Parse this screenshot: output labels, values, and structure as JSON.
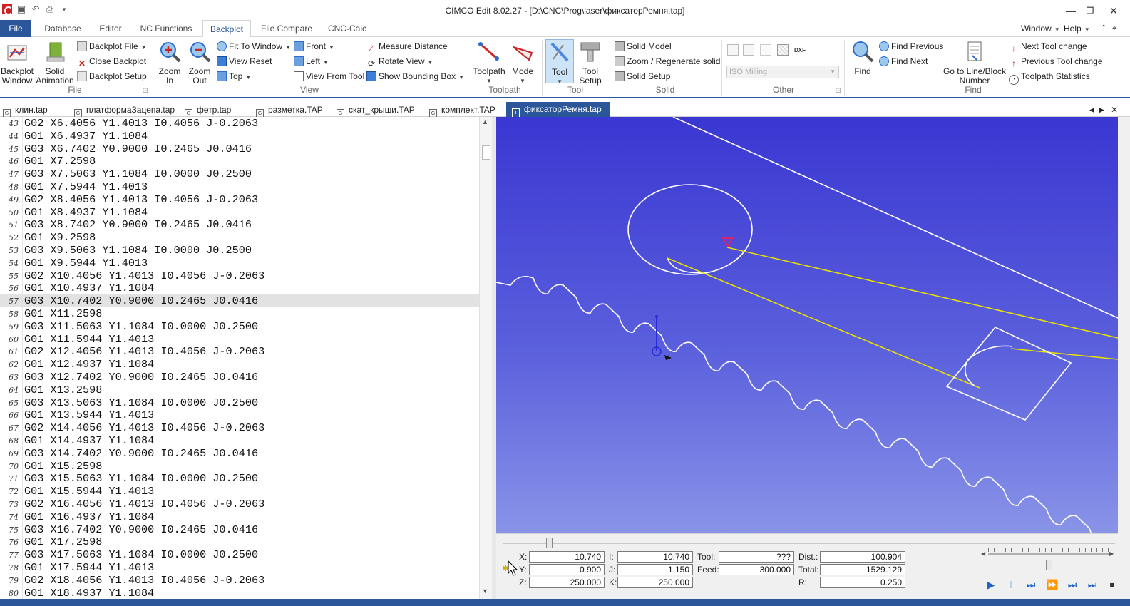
{
  "window": {
    "title": "CIMCO Edit 8.02.27 - [D:\\CNC\\Prog\\laser\\фиксаторРемня.tap]",
    "controls": [
      "—",
      "❐",
      "✕"
    ]
  },
  "ribbon_tabs": [
    "File",
    "Database",
    "Editor",
    "NC Functions",
    "Backplot",
    "File Compare",
    "CNC-Calc"
  ],
  "right_menus": [
    "Window",
    "Help"
  ],
  "ribbon": {
    "file_group": {
      "label": "File",
      "backplot_window": "Backplot\nWindow",
      "solid_animation": "Solid\nAnimation",
      "backplot_file": "Backplot File",
      "close_backplot": "Close Backplot",
      "backplot_setup": "Backplot Setup"
    },
    "view_group": {
      "label": "View",
      "zoom_in": "Zoom\nIn",
      "zoom_out": "Zoom\nOut",
      "fit_to_window": "Fit To Window",
      "view_reset": "View Reset",
      "top": "Top",
      "front": "Front",
      "left": "Left",
      "view_from_tool": "View From Tool",
      "measure_distance": "Measure Distance",
      "rotate_view": "Rotate View",
      "show_bounding_box": "Show Bounding Box"
    },
    "toolpath_group": {
      "label": "Toolpath",
      "toolpath": "Toolpath",
      "mode": "Mode"
    },
    "tool_group": {
      "label": "Tool",
      "tool": "Tool",
      "tool_setup": "Tool\nSetup"
    },
    "solid_group": {
      "label": "Solid",
      "solid_model": "Solid Model",
      "zoom_regenerate": "Zoom / Regenerate solid",
      "solid_setup": "Solid Setup"
    },
    "other_group": {
      "label": "Other",
      "combo_value": "ISO Milling",
      "dxf_label": "DXF"
    },
    "find_group": {
      "label": "Find",
      "find": "Find",
      "find_previous": "Find Previous",
      "find_next": "Find Next",
      "goto_line": "Go to Line/Block\nNumber",
      "next_tool_change": "Next Tool change",
      "previous_tool_change": "Previous Tool change",
      "toolpath_statistics": "Toolpath Statistics"
    }
  },
  "doc_tabs": [
    {
      "name": "клин.tap",
      "active": false
    },
    {
      "name": "платформаЗацепа.tap",
      "active": false
    },
    {
      "name": "фетр.tap",
      "active": false
    },
    {
      "name": "разметка.TAP",
      "active": false
    },
    {
      "name": "скат_крыши.TAP",
      "active": false
    },
    {
      "name": "комплект.TAP",
      "active": false
    },
    {
      "name": "фиксаторРемня.tap",
      "active": true
    }
  ],
  "editor": {
    "current_line": 57,
    "lines": [
      {
        "n": "43",
        "code": "G02 X6.4056 Y1.4013 I0.4056 J-0.2063"
      },
      {
        "n": "44",
        "code": "G01 X6.4937 Y1.1084"
      },
      {
        "n": "45",
        "code": "G03 X6.7402 Y0.9000 I0.2465 J0.0416"
      },
      {
        "n": "46",
        "code": "G01 X7.2598"
      },
      {
        "n": "47",
        "code": "G03 X7.5063 Y1.1084 I0.0000 J0.2500"
      },
      {
        "n": "48",
        "code": "G01 X7.5944 Y1.4013"
      },
      {
        "n": "49",
        "code": "G02 X8.4056 Y1.4013 I0.4056 J-0.2063"
      },
      {
        "n": "50",
        "code": "G01 X8.4937 Y1.1084"
      },
      {
        "n": "51",
        "code": "G03 X8.7402 Y0.9000 I0.2465 J0.0416"
      },
      {
        "n": "52",
        "code": "G01 X9.2598"
      },
      {
        "n": "53",
        "code": "G03 X9.5063 Y1.1084 I0.0000 J0.2500"
      },
      {
        "n": "54",
        "code": "G01 X9.5944 Y1.4013"
      },
      {
        "n": "55",
        "code": "G02 X10.4056 Y1.4013 I0.4056 J-0.2063"
      },
      {
        "n": "56",
        "code": "G01 X10.4937 Y1.1084"
      },
      {
        "n": "57",
        "code": "G03 X10.7402 Y0.9000 I0.2465 J0.0416"
      },
      {
        "n": "58",
        "code": "G01 X11.2598"
      },
      {
        "n": "59",
        "code": "G03 X11.5063 Y1.1084 I0.0000 J0.2500"
      },
      {
        "n": "60",
        "code": "G01 X11.5944 Y1.4013"
      },
      {
        "n": "61",
        "code": "G02 X12.4056 Y1.4013 I0.4056 J-0.2063"
      },
      {
        "n": "62",
        "code": "G01 X12.4937 Y1.1084"
      },
      {
        "n": "63",
        "code": "G03 X12.7402 Y0.9000 I0.2465 J0.0416"
      },
      {
        "n": "64",
        "code": "G01 X13.2598"
      },
      {
        "n": "65",
        "code": "G03 X13.5063 Y1.1084 I0.0000 J0.2500"
      },
      {
        "n": "66",
        "code": "G01 X13.5944 Y1.4013"
      },
      {
        "n": "67",
        "code": "G02 X14.4056 Y1.4013 I0.4056 J-0.2063"
      },
      {
        "n": "68",
        "code": "G01 X14.4937 Y1.1084"
      },
      {
        "n": "69",
        "code": "G03 X14.7402 Y0.9000 I0.2465 J0.0416"
      },
      {
        "n": "70",
        "code": "G01 X15.2598"
      },
      {
        "n": "71",
        "code": "G03 X15.5063 Y1.1084 I0.0000 J0.2500"
      },
      {
        "n": "72",
        "code": "G01 X15.5944 Y1.4013"
      },
      {
        "n": "73",
        "code": "G02 X16.4056 Y1.4013 I0.4056 J-0.2063"
      },
      {
        "n": "74",
        "code": "G01 X16.4937 Y1.1084"
      },
      {
        "n": "75",
        "code": "G03 X16.7402 Y0.9000 I0.2465 J0.0416"
      },
      {
        "n": "76",
        "code": "G01 X17.2598"
      },
      {
        "n": "77",
        "code": "G03 X17.5063 Y1.1084 I0.0000 J0.2500"
      },
      {
        "n": "78",
        "code": "G01 X17.5944 Y1.4013"
      },
      {
        "n": "79",
        "code": "G02 X18.4056 Y1.4013 I0.4056 J-0.2063"
      },
      {
        "n": "80",
        "code": "G01 X18.4937 Y1.1084"
      }
    ]
  },
  "viewport": {
    "background_top": "#3a37d2",
    "background_bottom": "#8994e8",
    "path_color": "#ffffff",
    "rapid_color": "#e8e000",
    "tool_marker_color": "#e0206a"
  },
  "position_panel": {
    "timeline_position": 0.07,
    "speed_position": 0.5,
    "fields": {
      "x_label": "X:",
      "x_value": "10.740",
      "y_label": "Y:",
      "y_value": "0.900",
      "z_label": "Z:",
      "z_value": "250.000",
      "i_label": "I:",
      "i_value": "10.740",
      "j_label": "J:",
      "j_value": "1.150",
      "k_label": "K:",
      "k_value": "250.000",
      "tool_label": "Tool:",
      "tool_value": "???",
      "feed_label": "Feed:",
      "feed_value": "300.000",
      "dist_label": "Dist.:",
      "dist_value": "100.904",
      "total_label": "Total:",
      "total_value": "1529.129",
      "r_label": "R:",
      "r_value": "0.250"
    }
  }
}
